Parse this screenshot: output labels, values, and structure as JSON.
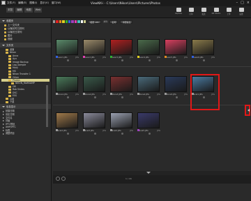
{
  "window": {
    "title": "ViewNX-i - C:\\Users\\Nikon\\Users\\Pictures\\Photos",
    "menu": [
      "文件(F)",
      "编辑(E)",
      "图像(I)",
      "显示(V)",
      "窗口(W)"
    ]
  },
  "toolbar": {
    "tabs": [
      "浏览",
      "编辑",
      "地图",
      "Web"
    ],
    "tools": [
      "Capture",
      "打印",
      "发送",
      "NX Studio",
      "上传",
      "设置"
    ]
  },
  "sidebar": {
    "favorites_title": "收藏夹",
    "favorites": [
      "上一文件夹",
      "以曝光时日排列",
      "以曝光日排列"
    ],
    "recent": [
      "图片",
      "视频"
    ],
    "folders_title": "文件夹",
    "tree": [
      "桌面",
      "Nikon",
      "Anna",
      "Ayu",
      "Image Backup",
      "Log_Sample",
      "Mary",
      "MS",
      "Nikon Transfer 1",
      "Other",
      "Photos",
      "NIKON_RAWSAMP",
      "OB",
      "Rob Sintes",
      "DSC",
      "ESS",
      "公用",
      "下载"
    ],
    "selected_tree_index": 10,
    "metadata_title": "信息显示",
    "metadata": [
      "拍摄日期",
      "设定日期",
      "文件名",
      "评级",
      "IPTC预设",
      "XMP/IPTC",
      "标签",
      "调整项目"
    ]
  },
  "filterbar": {
    "label_colors": [
      "#9a9a9a",
      "#e02020",
      "#e08a20",
      "#e0d020",
      "#30b030",
      "#3060e0",
      "#a040c0",
      "#e040b0",
      "#40c0c0",
      "#ffffff",
      "#cccc88"
    ],
    "sort_label": "排列",
    "sort_value": "名称",
    "filter_value": "相册 ABC",
    "view_label": "详细信息"
  },
  "thumbnails": [
    {
      "name": "Flower1.JPG",
      "color": "#5a8a6a",
      "label": "#3060e0"
    },
    {
      "name": "Flower2.JPG",
      "color": "#9a8a6a",
      "label": "#e040b0"
    },
    {
      "name": "Flower3.JPG",
      "color": "#b02020",
      "label": "#30b030"
    },
    {
      "name": "Flower4.JPG",
      "color": "#4a6a4a",
      "label": "#e0d020"
    },
    {
      "name": "Flower5.JPG",
      "color": "#d84060",
      "label": "#e08a20"
    },
    {
      "name": "Flower6.JPG",
      "color": "#8a7a4a",
      "label": "#3060e0"
    },
    {
      "name": "Nature1.JPG",
      "color": "#4a7a5a",
      "label": "#9a9a9a"
    },
    {
      "name": "Nature2.JPG",
      "color": "#3a5a4a",
      "label": "#9a9a9a"
    },
    {
      "name": "Nature3.JPG",
      "color": "#7a3030",
      "label": "#9a9a9a"
    },
    {
      "name": "Nature4.JPG",
      "color": "#4a6a7a",
      "label": "#9a9a9a"
    },
    {
      "name": "Nature5.JPG",
      "color": "#2a3a5a",
      "label": "#9a9a9a"
    },
    {
      "name": "Travel1.JPG",
      "color": "#4a7aa0",
      "label": "#9a9a9a"
    },
    {
      "name": "Travel2.JPG",
      "color": "#a07a4a",
      "label": "#9a9a9a"
    },
    {
      "name": "Travel3.JPG",
      "color": "#8a8a9a",
      "label": "#9a9a9a"
    },
    {
      "name": "Travel4.JPG",
      "color": "#9aa0b0",
      "label": "#9a9a9a"
    },
    {
      "name": "Travel5.JPG",
      "color": "#3a3a6a",
      "label": "#a040c0"
    }
  ],
  "selected_thumbnail_index": 11,
  "thumb_ext": "JPG",
  "status": {
    "count": "1 / 16"
  }
}
